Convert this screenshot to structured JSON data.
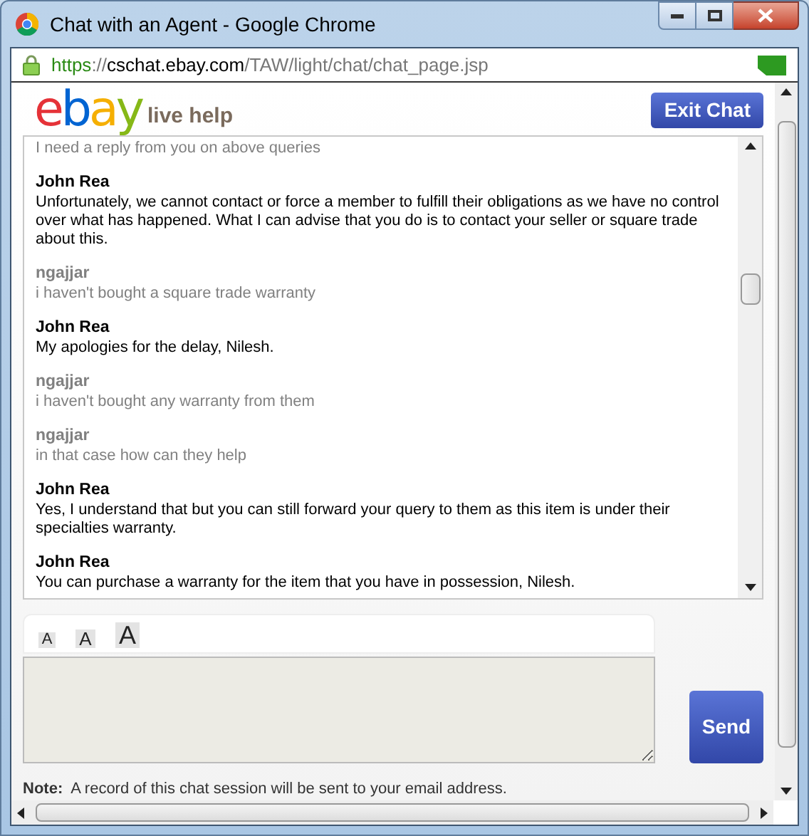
{
  "window": {
    "title": "Chat with an Agent - Google Chrome"
  },
  "address_bar": {
    "url_parts": [
      {
        "kind": "scheme",
        "text": "https"
      },
      {
        "kind": "separator",
        "text": "://"
      },
      {
        "kind": "host",
        "text": "cschat.ebay.com"
      },
      {
        "kind": "path",
        "text": "/TAW/light/chat/chat_page.jsp"
      }
    ]
  },
  "header": {
    "logo_letters": [
      {
        "text": "e",
        "color": "#e53238"
      },
      {
        "text": "b",
        "color": "#0064d2"
      },
      {
        "text": "a",
        "color": "#f5af02"
      },
      {
        "text": "y",
        "color": "#86b817"
      }
    ],
    "logo_suffix": "live help",
    "exit_button": "Exit Chat"
  },
  "messages": [
    {
      "kind": "customer",
      "text": "I need a reply from you on above queries"
    },
    {
      "kind": "agent",
      "sender": "John Rea",
      "text": "Unfortunately, we cannot contact or force a member to fulfill their obligations as we have no control over what has happened. What I can advise that you do is to contact your seller or square trade about this."
    },
    {
      "kind": "customer",
      "sender": "ngajjar",
      "text": "i haven't bought a square trade warranty"
    },
    {
      "kind": "agent",
      "sender": "John Rea",
      "text": "My apologies for the delay, Nilesh."
    },
    {
      "kind": "customer",
      "sender": "ngajjar",
      "text": "i haven't bought any warranty from them"
    },
    {
      "kind": "customer",
      "sender": "ngajjar",
      "text": "in that case how can they help"
    },
    {
      "kind": "agent",
      "sender": "John Rea",
      "text": "Yes, I understand that but you can still forward your query to them as this item is under their specialties warranty."
    },
    {
      "kind": "agent",
      "sender": "John Rea",
      "text": "You can purchase a warranty for the item that you have in possession, Nilesh."
    }
  ],
  "font_size_buttons": [
    {
      "kind": "small",
      "label": "A"
    },
    {
      "kind": "medium",
      "label": "A"
    },
    {
      "kind": "large",
      "label": "A"
    }
  ],
  "send_button": "Send",
  "note": {
    "label": "Note:",
    "text": "A record of this chat session will be sent to your email address."
  }
}
